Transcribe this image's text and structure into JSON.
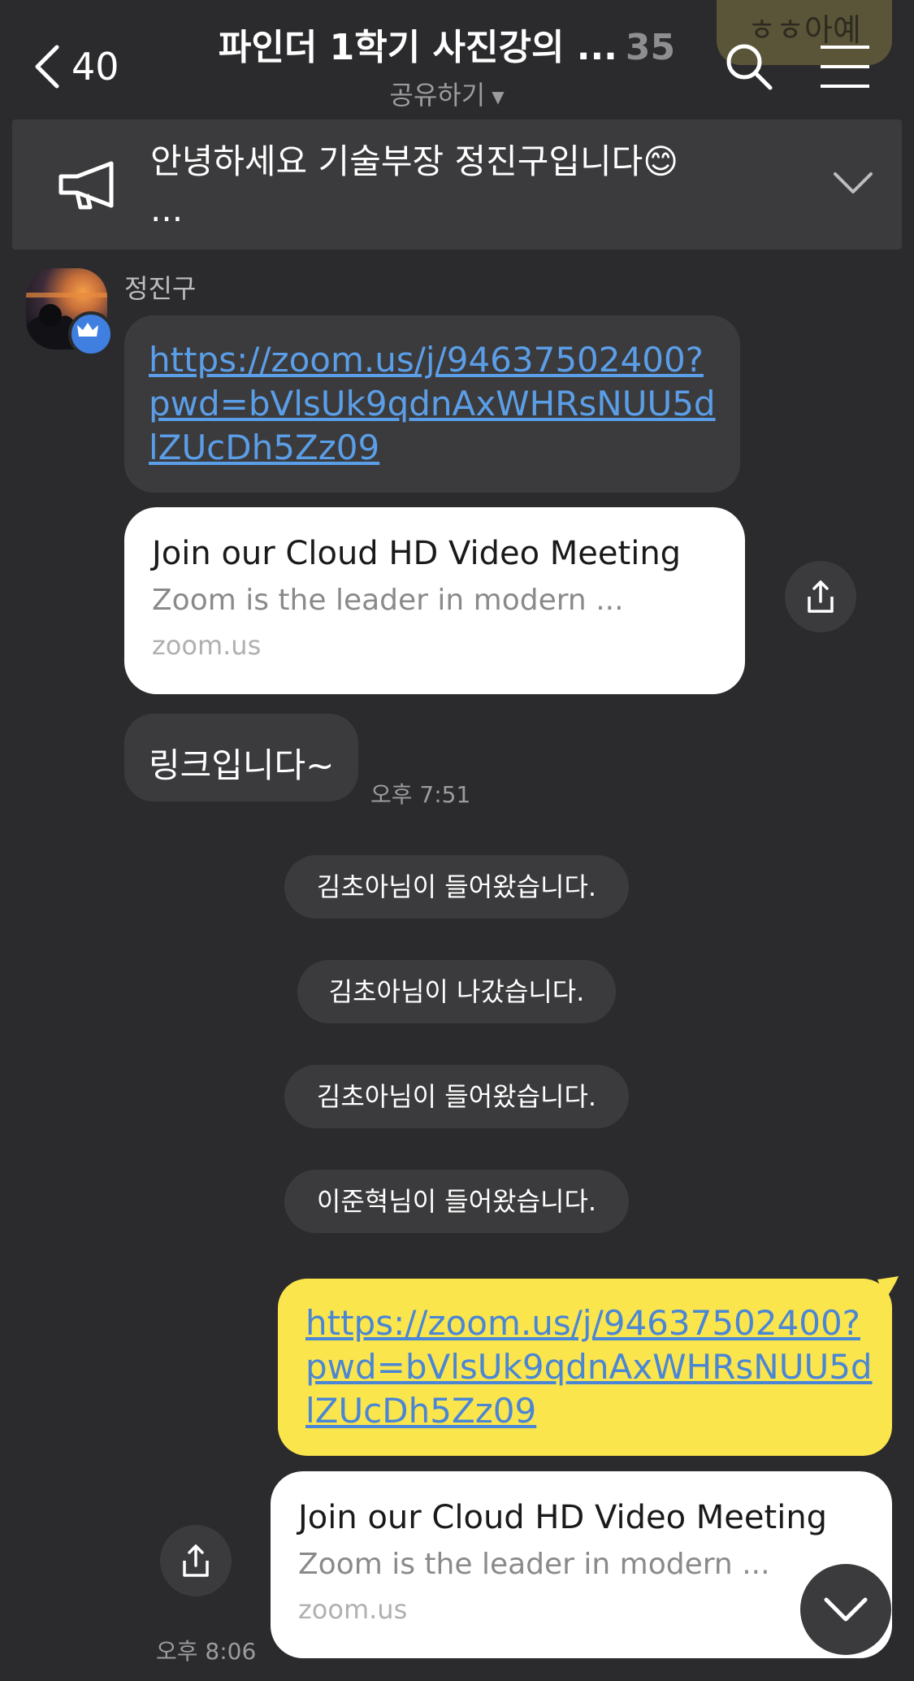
{
  "header": {
    "back_count": "40",
    "title": "파인더 1학기 사진강의 ...",
    "member_count": "35",
    "subtitle": "공유하기",
    "ghost_bubble_text": "ㅎㅎ아예"
  },
  "notice": {
    "text": "안녕하세요 기술부장 정진구입니다😊",
    "ellipsis": "..."
  },
  "messages": {
    "sender_name": "정진구",
    "link1": "https://zoom.us/j/94637502400?pwd=bVlsUk9qdnAxWHRsNUU5dlZUcDh5Zz09",
    "card1": {
      "title": "Join our Cloud HD Video Meeting",
      "desc": "Zoom is the leader in modern ...",
      "domain": "zoom.us"
    },
    "text1": "링크입니다~",
    "time1": "오후 7:51",
    "system": [
      "김초아님이 들어왔습니다.",
      "김초아님이 나갔습니다.",
      "김초아님이 들어왔습니다.",
      "이준혁님이 들어왔습니다."
    ],
    "link2": "https://zoom.us/j/94637502400?pwd=bVlsUk9qdnAxWHRsNUU5dlZUcDh5Zz09",
    "card2": {
      "title": "Join our Cloud HD Video Meeting",
      "desc": "Zoom is the leader in modern ...",
      "domain": "zoom.us"
    },
    "time2": "오후 8:06"
  },
  "colors": {
    "background": "#2b2b2d",
    "bubble_dark": "#3b3b3d",
    "bubble_mine": "#fbe54c",
    "link": "#5b9ee8"
  },
  "icons": [
    "chevron-left-icon",
    "search-icon",
    "menu-icon",
    "megaphone-icon",
    "chevron-down-icon",
    "crown-icon",
    "share-icon"
  ]
}
